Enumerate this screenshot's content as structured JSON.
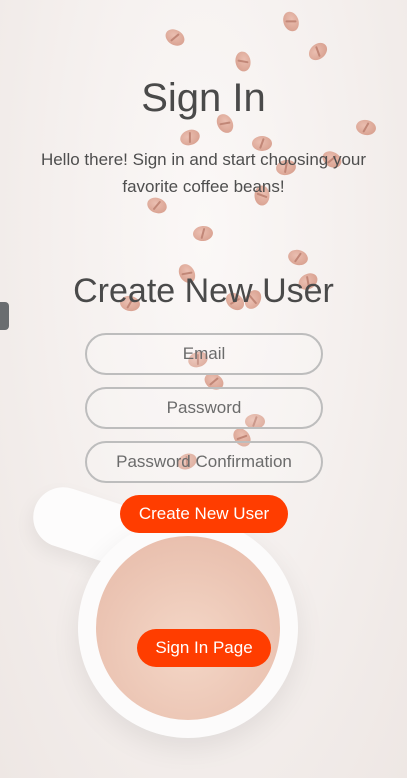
{
  "signin": {
    "title": "Sign In",
    "subtitle": "Hello there! Sign in and start choosing your favorite coffee beans!"
  },
  "create_user": {
    "title": "Create New User",
    "email_placeholder": "Email",
    "password_placeholder": "Password",
    "confirm_placeholder": "Password Confirmation",
    "submit_label": "Create New User"
  },
  "nav": {
    "signin_page_label": "Sign In Page"
  },
  "colors": {
    "accent": "#ff3d00",
    "text": "#4a4a4a",
    "field_border": "#bdbdbd"
  }
}
